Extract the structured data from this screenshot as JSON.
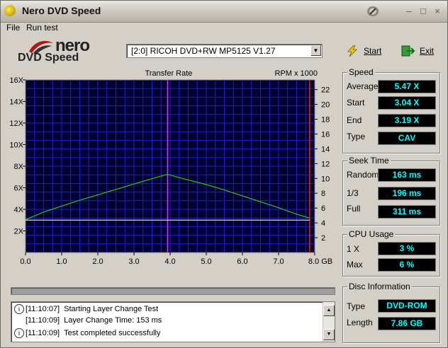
{
  "window": {
    "title": "Nero DVD Speed"
  },
  "menu": {
    "file": "File",
    "run_test": "Run test"
  },
  "logo": {
    "brand": "nero",
    "product": "DVD Speed"
  },
  "drive": {
    "selected": "[2:0]  RICOH DVD+RW MP5125 V1.27"
  },
  "toolbar": {
    "start": "Start",
    "exit": "Exit"
  },
  "chart_data": {
    "type": "line",
    "title": "Transfer Rate",
    "right_axis_label": "RPM x 1000",
    "x_unit": "GB",
    "x_ticks": [
      0.0,
      1.0,
      2.0,
      3.0,
      4.0,
      5.0,
      6.0,
      7.0,
      8.0
    ],
    "x_tick_labels": [
      "0.0",
      "1.0",
      "2.0",
      "3.0",
      "4.0",
      "5.0",
      "6.0",
      "7.0",
      "8.0 GB"
    ],
    "y_ticks": [
      2,
      4,
      6,
      8,
      10,
      12,
      14,
      16
    ],
    "y_tick_labels": [
      "2X",
      "4X",
      "6X",
      "8X",
      "10X",
      "12X",
      "14X",
      "16X"
    ],
    "y2_ticks": [
      2,
      4,
      6,
      8,
      10,
      12,
      14,
      16,
      18,
      20,
      22
    ],
    "xlim": [
      0,
      8
    ],
    "ylim": [
      0,
      16
    ],
    "y2lim": [
      0,
      23.3
    ],
    "grid": true,
    "layer_break_x": 3.93,
    "end_marker_x": 7.86,
    "series": [
      {
        "color": "#22cc22",
        "x": [
          0,
          0.5,
          1.0,
          1.5,
          2.0,
          2.5,
          3.0,
          3.5,
          3.93,
          4.3,
          5.0,
          5.5,
          6.0,
          6.5,
          7.0,
          7.5,
          7.86
        ],
        "y": [
          3.04,
          3.75,
          4.3,
          4.85,
          5.35,
          5.85,
          6.35,
          6.85,
          7.25,
          6.9,
          6.3,
          5.8,
          5.25,
          4.7,
          4.15,
          3.55,
          3.19
        ]
      },
      {
        "color": "#e8e070",
        "x": [
          0,
          1.0,
          2.0,
          3.0,
          3.93,
          5.0,
          6.0,
          7.0,
          7.86
        ],
        "y": [
          3.0,
          3.0,
          3.0,
          3.0,
          3.0,
          3.0,
          3.0,
          3.0,
          3.0
        ]
      }
    ]
  },
  "log": {
    "lines": [
      {
        "time": "[11:10:07]",
        "msg": "Starting Layer Change Test"
      },
      {
        "time": "[11:10:09]",
        "msg": "Layer Change Time:  153 ms"
      },
      {
        "time": "[11:10:09]",
        "msg": "Test completed successfully"
      }
    ]
  },
  "speed": {
    "title": "Speed",
    "average_label": "Average",
    "average": "5.47 X",
    "start_label": "Start",
    "start": "3.04 X",
    "end_label": "End",
    "end": "3.19 X",
    "type_label": "Type",
    "type": "CAV"
  },
  "seek": {
    "title": "Seek Time",
    "random_label": "Random",
    "random": "163 ms",
    "third_label": "1/3",
    "third": "196 ms",
    "full_label": "Full",
    "full": "311 ms"
  },
  "cpu": {
    "title": "CPU Usage",
    "x1_label": "1 X",
    "x1": "3 %",
    "max_label": "Max",
    "max": "6 %"
  },
  "disc": {
    "title": "Disc Information",
    "type_label": "Type",
    "type": "DVD-ROM",
    "length_label": "Length",
    "length": "7.86 GB"
  }
}
